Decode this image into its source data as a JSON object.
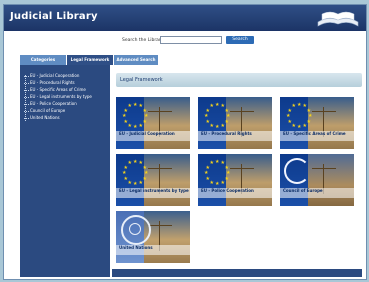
{
  "app": {
    "title": "Judicial Library"
  },
  "search": {
    "label": "Search the Library",
    "input_value": "",
    "button_label": "Search"
  },
  "tabs": [
    {
      "label": "Categories"
    },
    {
      "label": "Legal Framework"
    },
    {
      "label": "Advanced Search"
    }
  ],
  "sidebar": {
    "items": [
      {
        "label": "EU - Judicial Cooperation"
      },
      {
        "label": "EU - Procedural Rights"
      },
      {
        "label": "EU - Specific Areas of Crime"
      },
      {
        "label": "EU - Legal instruments by type"
      },
      {
        "label": "EU - Police Cooperation"
      },
      {
        "label": "Council of Europe"
      },
      {
        "label": "United Nations"
      }
    ]
  },
  "main": {
    "section_title": "Legal Framework",
    "tiles": [
      {
        "caption": "EU - Judicial Cooperation",
        "kind": "eu"
      },
      {
        "caption": "EU - Procedural Rights",
        "kind": "eu"
      },
      {
        "caption": "EU - Specific Areas of Crime",
        "kind": "eu"
      },
      {
        "caption": "EU - Legal instruments by type",
        "kind": "eu"
      },
      {
        "caption": "EU - Police Cooperation",
        "kind": "eu"
      },
      {
        "caption": "Council of Europe",
        "kind": "coe"
      },
      {
        "caption": "United Nations",
        "kind": "un"
      }
    ]
  },
  "colors": {
    "header": "#1c3466",
    "accent": "#2d6bb5",
    "sidebar": "#2b4a80",
    "star": "#f4d21c"
  }
}
